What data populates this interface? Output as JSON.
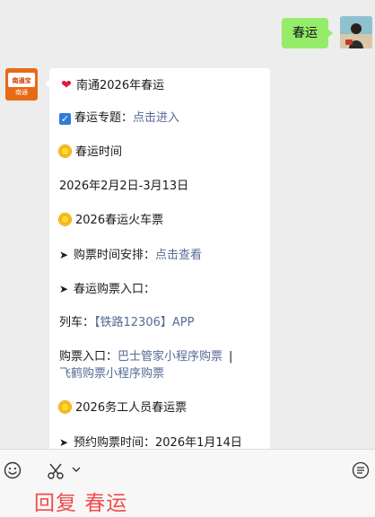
{
  "outgoing": {
    "text": "春运"
  },
  "incoming": {
    "sender_logo": {
      "name": "南通宝",
      "sub": "南通"
    },
    "lines": {
      "l1": "南通2026年春运",
      "l2_label": "春运专题：",
      "l2_link": "点击进入",
      "l3": "春运时间",
      "l4": "2026年2月2日-3月13日",
      "l5": "2026春运火车票",
      "l6_label": "购票时间安排：",
      "l6_link": "点击查看",
      "l7": "春运购票入口：",
      "l8_label": "列车：",
      "l8_link": "【铁路12306】APP",
      "l9_label": "购票入口：",
      "l9_link": "巴士管家小程序购票",
      "l9_sep": "|",
      "l10_link": "飞鹤购票小程序购票",
      "l11": "2026务工人员春运票",
      "l12": "预约购票时间：2026年1月14日"
    }
  },
  "toolbar": {
    "reply_hint": "回复 春运"
  },
  "icons": {
    "heart": "heart-icon",
    "check": "checkbox-icon",
    "sun": "sun-icon",
    "arrow": "arrow-right-icon",
    "emoji": "emoji-icon",
    "scissors": "scissors-icon",
    "chevron": "chevron-down-icon",
    "more": "more-icon"
  }
}
